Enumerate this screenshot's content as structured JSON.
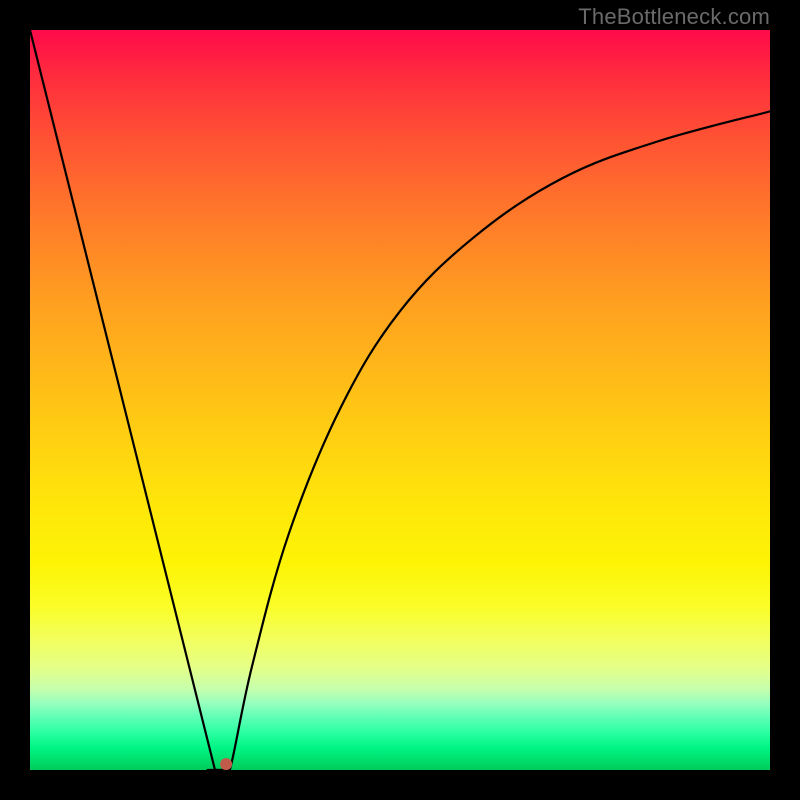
{
  "attribution": "TheBottleneck.com",
  "chart_data": {
    "type": "line",
    "title": "",
    "xlabel": "",
    "ylabel": "",
    "xlim": [
      0,
      100
    ],
    "ylim": [
      0,
      100
    ],
    "curve": {
      "left_branch": {
        "x0": 0,
        "y0": 100,
        "x1": 25,
        "y1": 0
      },
      "minimum": {
        "x": 26,
        "y": 0
      },
      "right_branch": [
        {
          "x": 27,
          "y": 0
        },
        {
          "x": 30,
          "y": 14
        },
        {
          "x": 35,
          "y": 32
        },
        {
          "x": 42,
          "y": 49
        },
        {
          "x": 50,
          "y": 62
        },
        {
          "x": 60,
          "y": 72
        },
        {
          "x": 72,
          "y": 80
        },
        {
          "x": 85,
          "y": 85
        },
        {
          "x": 100,
          "y": 89
        }
      ]
    },
    "marker": {
      "x": 26.5,
      "y": 0.8,
      "color": "#c05b4a"
    },
    "gradient_stops": [
      {
        "pct": 0,
        "color": "#ff0a4a"
      },
      {
        "pct": 100,
        "color": "#00cc58"
      }
    ]
  }
}
